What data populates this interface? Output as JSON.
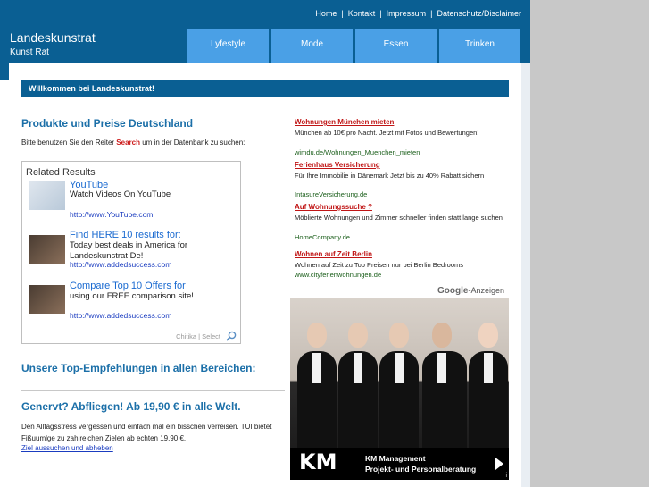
{
  "header": {
    "title": "Landeskunstrat",
    "subtitle": "Kunst Rat",
    "topnav": [
      "Home",
      "Kontakt",
      "Impressum",
      "Datenschutz/Disclaimer"
    ],
    "separator": "|",
    "tabs": [
      "Lyfestyle",
      "Mode",
      "Essen",
      "Trinken"
    ]
  },
  "welcome": "Willkommen bei Landeskunstrat!",
  "main": {
    "heading": "Produkte und Preise Deutschland",
    "intro_before": "Bitte benutzen Sie den Reiter ",
    "intro_highlight": "Search",
    "intro_after": " um in der Datenbank zu suchen:",
    "related": {
      "title": "Related Results",
      "items": [
        {
          "title": "YouTube",
          "desc": "Watch Videos On YouTube",
          "url": "http://www.YouTube.com"
        },
        {
          "title": "Find HERE 10 results for:",
          "desc": "Today best deals in America for Landeskunstrat De!",
          "url": "http://www.addedsuccess.com"
        },
        {
          "title": "Compare Top 10 Offers for",
          "desc": "using our FREE comparison site!",
          "url": "http://www.addedsuccess.com"
        }
      ],
      "footer": "Chitika | Select"
    },
    "top_heading": "Unsere Top-Empfehlungen in allen Bereichen:",
    "promo_heading": "Genervt? Abfliegen! Ab 19,90 € in alle Welt.",
    "promo_text": "Den Alltagsstress vergessen und einfach mal ein bisschen verreisen. TUI bietet Fißuumlge zu zahlreichen Zielen ab echten 19,90 €.",
    "promo_link": "Ziel aussuchen und abheben"
  },
  "ads": {
    "items": [
      {
        "title": "Wohnungen München mieten",
        "text": "München ab 10€ pro Nacht. Jetzt mit Fotos und Bewertungen!",
        "url": "wimdu.de/Wohnungen_Muenchen_mieten"
      },
      {
        "title": "Ferienhaus Versicherung",
        "text": "Für Ihre Immobilie in Dänemark Jetzt bis zu 40% Rabatt sichern",
        "url": "IntasureVersicherung.de"
      },
      {
        "title": "Auf Wohnungssuche ?",
        "text": "Möblierte Wohnungen und Zimmer schneller finden statt lange suchen",
        "url": "HomeCompany.de"
      },
      {
        "title": "Wohnen auf Zeit Berlin",
        "text": "Wohnen auf Zeit zu Top Preisen nur bei Berlin Bedrooms",
        "url": "www.cityferienwohnungen.de"
      }
    ],
    "google_brand": "Google",
    "google_suffix": "-Anzeigen"
  },
  "banner": {
    "logo": "KM",
    "line1": "KM Management",
    "line2": "Projekt- und Personalberatung",
    "info": "i"
  }
}
